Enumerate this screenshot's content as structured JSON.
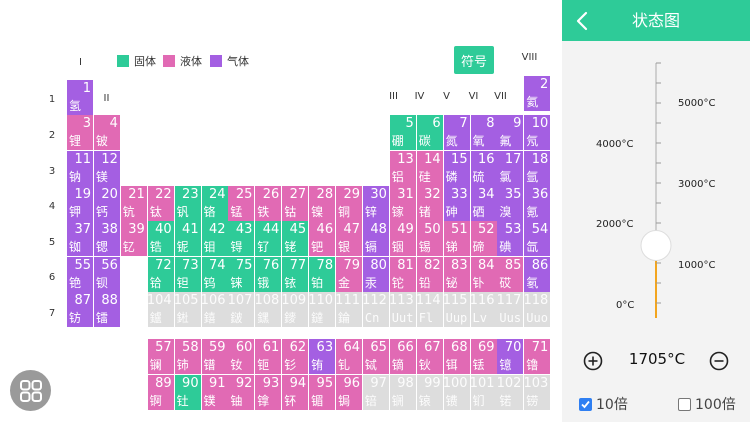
{
  "colors": {
    "solid": "#2ecb98",
    "liquid": "#e16ab4",
    "gas": "#a45fe2",
    "unknown": "#dddddd",
    "accent": "#2ecb98",
    "thermo_fill": "#f2a51f"
  },
  "legend": [
    {
      "label": "固体",
      "state": "solid"
    },
    {
      "label": "液体",
      "state": "liquid"
    },
    {
      "label": "气体",
      "state": "gas"
    }
  ],
  "symbol_button": "符号",
  "group_labels": [
    "I",
    "II",
    "III",
    "IV",
    "V",
    "VI",
    "VII",
    "VIII"
  ],
  "period_labels": [
    "1",
    "2",
    "3",
    "4",
    "5",
    "6",
    "7"
  ],
  "elements": [
    {
      "n": "1",
      "name": "氢",
      "row": 1,
      "col": 1,
      "state": "gas"
    },
    {
      "n": "2",
      "name": "氦",
      "row": 1,
      "col": 18,
      "state": "gas"
    },
    {
      "n": "3",
      "name": "锂",
      "row": 2,
      "col": 1,
      "state": "liquid"
    },
    {
      "n": "4",
      "name": "铍",
      "row": 2,
      "col": 2,
      "state": "liquid"
    },
    {
      "n": "5",
      "name": "硼",
      "row": 2,
      "col": 13,
      "state": "solid"
    },
    {
      "n": "6",
      "name": "碳",
      "row": 2,
      "col": 14,
      "state": "solid"
    },
    {
      "n": "7",
      "name": "氮",
      "row": 2,
      "col": 15,
      "state": "gas"
    },
    {
      "n": "8",
      "name": "氧",
      "row": 2,
      "col": 16,
      "state": "gas"
    },
    {
      "n": "9",
      "name": "氟",
      "row": 2,
      "col": 17,
      "state": "gas"
    },
    {
      "n": "10",
      "name": "氖",
      "row": 2,
      "col": 18,
      "state": "gas"
    },
    {
      "n": "11",
      "name": "钠",
      "row": 3,
      "col": 1,
      "state": "gas"
    },
    {
      "n": "12",
      "name": "镁",
      "row": 3,
      "col": 2,
      "state": "gas"
    },
    {
      "n": "13",
      "name": "铝",
      "row": 3,
      "col": 13,
      "state": "liquid"
    },
    {
      "n": "14",
      "name": "硅",
      "row": 3,
      "col": 14,
      "state": "liquid"
    },
    {
      "n": "15",
      "name": "磷",
      "row": 3,
      "col": 15,
      "state": "gas"
    },
    {
      "n": "16",
      "name": "硫",
      "row": 3,
      "col": 16,
      "state": "gas"
    },
    {
      "n": "17",
      "name": "氯",
      "row": 3,
      "col": 17,
      "state": "gas"
    },
    {
      "n": "18",
      "name": "氩",
      "row": 3,
      "col": 18,
      "state": "gas"
    },
    {
      "n": "19",
      "name": "钾",
      "row": 4,
      "col": 1,
      "state": "gas"
    },
    {
      "n": "20",
      "name": "钙",
      "row": 4,
      "col": 2,
      "state": "gas"
    },
    {
      "n": "21",
      "name": "钪",
      "row": 4,
      "col": 3,
      "state": "liquid"
    },
    {
      "n": "22",
      "name": "钛",
      "row": 4,
      "col": 4,
      "state": "liquid"
    },
    {
      "n": "23",
      "name": "钒",
      "row": 4,
      "col": 5,
      "state": "solid"
    },
    {
      "n": "24",
      "name": "铬",
      "row": 4,
      "col": 6,
      "state": "solid"
    },
    {
      "n": "25",
      "name": "锰",
      "row": 4,
      "col": 7,
      "state": "liquid"
    },
    {
      "n": "26",
      "name": "铁",
      "row": 4,
      "col": 8,
      "state": "liquid"
    },
    {
      "n": "27",
      "name": "钴",
      "row": 4,
      "col": 9,
      "state": "liquid"
    },
    {
      "n": "28",
      "name": "镍",
      "row": 4,
      "col": 10,
      "state": "liquid"
    },
    {
      "n": "29",
      "name": "铜",
      "row": 4,
      "col": 11,
      "state": "liquid"
    },
    {
      "n": "30",
      "name": "锌",
      "row": 4,
      "col": 12,
      "state": "gas"
    },
    {
      "n": "31",
      "name": "镓",
      "row": 4,
      "col": 13,
      "state": "liquid"
    },
    {
      "n": "32",
      "name": "锗",
      "row": 4,
      "col": 14,
      "state": "liquid"
    },
    {
      "n": "33",
      "name": "砷",
      "row": 4,
      "col": 15,
      "state": "gas"
    },
    {
      "n": "34",
      "name": "硒",
      "row": 4,
      "col": 16,
      "state": "gas"
    },
    {
      "n": "35",
      "name": "溴",
      "row": 4,
      "col": 17,
      "state": "gas"
    },
    {
      "n": "36",
      "name": "氪",
      "row": 4,
      "col": 18,
      "state": "gas"
    },
    {
      "n": "37",
      "name": "铷",
      "row": 5,
      "col": 1,
      "state": "gas"
    },
    {
      "n": "38",
      "name": "锶",
      "row": 5,
      "col": 2,
      "state": "gas"
    },
    {
      "n": "39",
      "name": "钇",
      "row": 5,
      "col": 3,
      "state": "liquid"
    },
    {
      "n": "40",
      "name": "锆",
      "row": 5,
      "col": 4,
      "state": "solid"
    },
    {
      "n": "41",
      "name": "铌",
      "row": 5,
      "col": 5,
      "state": "solid"
    },
    {
      "n": "42",
      "name": "钼",
      "row": 5,
      "col": 6,
      "state": "solid"
    },
    {
      "n": "43",
      "name": "锝",
      "row": 5,
      "col": 7,
      "state": "solid"
    },
    {
      "n": "44",
      "name": "钌",
      "row": 5,
      "col": 8,
      "state": "solid"
    },
    {
      "n": "45",
      "name": "铑",
      "row": 5,
      "col": 9,
      "state": "solid"
    },
    {
      "n": "46",
      "name": "钯",
      "row": 5,
      "col": 10,
      "state": "liquid"
    },
    {
      "n": "47",
      "name": "银",
      "row": 5,
      "col": 11,
      "state": "liquid"
    },
    {
      "n": "48",
      "name": "镉",
      "row": 5,
      "col": 12,
      "state": "gas"
    },
    {
      "n": "49",
      "name": "铟",
      "row": 5,
      "col": 13,
      "state": "liquid"
    },
    {
      "n": "50",
      "name": "锡",
      "row": 5,
      "col": 14,
      "state": "liquid"
    },
    {
      "n": "51",
      "name": "锑",
      "row": 5,
      "col": 15,
      "state": "liquid"
    },
    {
      "n": "52",
      "name": "碲",
      "row": 5,
      "col": 16,
      "state": "liquid"
    },
    {
      "n": "53",
      "name": "碘",
      "row": 5,
      "col": 17,
      "state": "gas"
    },
    {
      "n": "54",
      "name": "氙",
      "row": 5,
      "col": 18,
      "state": "gas"
    },
    {
      "n": "55",
      "name": "铯",
      "row": 6,
      "col": 1,
      "state": "gas"
    },
    {
      "n": "56",
      "name": "钡",
      "row": 6,
      "col": 2,
      "state": "gas"
    },
    {
      "n": "72",
      "name": "铪",
      "row": 6,
      "col": 4,
      "state": "solid"
    },
    {
      "n": "73",
      "name": "钽",
      "row": 6,
      "col": 5,
      "state": "solid"
    },
    {
      "n": "74",
      "name": "钨",
      "row": 6,
      "col": 6,
      "state": "solid"
    },
    {
      "n": "75",
      "name": "铼",
      "row": 6,
      "col": 7,
      "state": "solid"
    },
    {
      "n": "76",
      "name": "锇",
      "row": 6,
      "col": 8,
      "state": "solid"
    },
    {
      "n": "77",
      "name": "铱",
      "row": 6,
      "col": 9,
      "state": "solid"
    },
    {
      "n": "78",
      "name": "铂",
      "row": 6,
      "col": 10,
      "state": "solid"
    },
    {
      "n": "79",
      "name": "金",
      "row": 6,
      "col": 11,
      "state": "liquid"
    },
    {
      "n": "80",
      "name": "汞",
      "row": 6,
      "col": 12,
      "state": "gas"
    },
    {
      "n": "81",
      "name": "铊",
      "row": 6,
      "col": 13,
      "state": "liquid"
    },
    {
      "n": "82",
      "name": "铅",
      "row": 6,
      "col": 14,
      "state": "liquid"
    },
    {
      "n": "83",
      "name": "铋",
      "row": 6,
      "col": 15,
      "state": "liquid"
    },
    {
      "n": "84",
      "name": "钋",
      "row": 6,
      "col": 16,
      "state": "liquid"
    },
    {
      "n": "85",
      "name": "砹",
      "row": 6,
      "col": 17,
      "state": "liquid"
    },
    {
      "n": "86",
      "name": "氡",
      "row": 6,
      "col": 18,
      "state": "gas"
    },
    {
      "n": "87",
      "name": "钫",
      "row": 7,
      "col": 1,
      "state": "gas"
    },
    {
      "n": "88",
      "name": "镭",
      "row": 7,
      "col": 2,
      "state": "gas"
    },
    {
      "n": "104",
      "name": "鑪",
      "row": 7,
      "col": 4,
      "state": "unknown"
    },
    {
      "n": "105",
      "name": "𨧀",
      "row": 7,
      "col": 5,
      "state": "unknown"
    },
    {
      "n": "106",
      "name": "𨭎",
      "row": 7,
      "col": 6,
      "state": "unknown"
    },
    {
      "n": "107",
      "name": "𨨏",
      "row": 7,
      "col": 7,
      "state": "unknown"
    },
    {
      "n": "108",
      "name": "𨭆",
      "row": 7,
      "col": 8,
      "state": "unknown"
    },
    {
      "n": "109",
      "name": "䥑",
      "row": 7,
      "col": 9,
      "state": "unknown"
    },
    {
      "n": "110",
      "name": "鐽",
      "row": 7,
      "col": 10,
      "state": "unknown"
    },
    {
      "n": "111",
      "name": "錀",
      "row": 7,
      "col": 11,
      "state": "unknown"
    },
    {
      "n": "112",
      "name": "Cn",
      "row": 7,
      "col": 12,
      "state": "unknown"
    },
    {
      "n": "113",
      "name": "Uut",
      "row": 7,
      "col": 13,
      "state": "unknown"
    },
    {
      "n": "114",
      "name": "Fl",
      "row": 7,
      "col": 14,
      "state": "unknown"
    },
    {
      "n": "115",
      "name": "Uup",
      "row": 7,
      "col": 15,
      "state": "unknown"
    },
    {
      "n": "116",
      "name": "Lv",
      "row": 7,
      "col": 16,
      "state": "unknown"
    },
    {
      "n": "117",
      "name": "Uus",
      "row": 7,
      "col": 17,
      "state": "unknown"
    },
    {
      "n": "118",
      "name": "Uuo",
      "row": 7,
      "col": 18,
      "state": "unknown"
    },
    {
      "n": "57",
      "name": "镧",
      "row": 8,
      "col": 4,
      "state": "liquid"
    },
    {
      "n": "58",
      "name": "铈",
      "row": 8,
      "col": 5,
      "state": "liquid"
    },
    {
      "n": "59",
      "name": "镨",
      "row": 8,
      "col": 6,
      "state": "liquid"
    },
    {
      "n": "60",
      "name": "钕",
      "row": 8,
      "col": 7,
      "state": "liquid"
    },
    {
      "n": "61",
      "name": "钷",
      "row": 8,
      "col": 8,
      "state": "liquid"
    },
    {
      "n": "62",
      "name": "钐",
      "row": 8,
      "col": 9,
      "state": "liquid"
    },
    {
      "n": "63",
      "name": "铕",
      "row": 8,
      "col": 10,
      "state": "gas"
    },
    {
      "n": "64",
      "name": "钆",
      "row": 8,
      "col": 11,
      "state": "liquid"
    },
    {
      "n": "65",
      "name": "铽",
      "row": 8,
      "col": 12,
      "state": "liquid"
    },
    {
      "n": "66",
      "name": "镝",
      "row": 8,
      "col": 13,
      "state": "liquid"
    },
    {
      "n": "67",
      "name": "钬",
      "row": 8,
      "col": 14,
      "state": "liquid"
    },
    {
      "n": "68",
      "name": "铒",
      "row": 8,
      "col": 15,
      "state": "liquid"
    },
    {
      "n": "69",
      "name": "铥",
      "row": 8,
      "col": 16,
      "state": "liquid"
    },
    {
      "n": "70",
      "name": "镱",
      "row": 8,
      "col": 17,
      "state": "gas"
    },
    {
      "n": "71",
      "name": "镥",
      "row": 8,
      "col": 18,
      "state": "liquid"
    },
    {
      "n": "89",
      "name": "锕",
      "row": 9,
      "col": 4,
      "state": "liquid"
    },
    {
      "n": "90",
      "name": "钍",
      "row": 9,
      "col": 5,
      "state": "solid"
    },
    {
      "n": "91",
      "name": "镤",
      "row": 9,
      "col": 6,
      "state": "liquid"
    },
    {
      "n": "92",
      "name": "铀",
      "row": 9,
      "col": 7,
      "state": "liquid"
    },
    {
      "n": "93",
      "name": "镎",
      "row": 9,
      "col": 8,
      "state": "liquid"
    },
    {
      "n": "94",
      "name": "钚",
      "row": 9,
      "col": 9,
      "state": "liquid"
    },
    {
      "n": "95",
      "name": "镅",
      "row": 9,
      "col": 10,
      "state": "liquid"
    },
    {
      "n": "96",
      "name": "锔",
      "row": 9,
      "col": 11,
      "state": "liquid"
    },
    {
      "n": "97",
      "name": "锫",
      "row": 9,
      "col": 12,
      "state": "unknown"
    },
    {
      "n": "98",
      "name": "锎",
      "row": 9,
      "col": 13,
      "state": "unknown"
    },
    {
      "n": "99",
      "name": "锿",
      "row": 9,
      "col": 14,
      "state": "unknown"
    },
    {
      "n": "100",
      "name": "镄",
      "row": 9,
      "col": 15,
      "state": "unknown"
    },
    {
      "n": "101",
      "name": "钔",
      "row": 9,
      "col": 16,
      "state": "unknown"
    },
    {
      "n": "102",
      "name": "锘",
      "row": 9,
      "col": 17,
      "state": "unknown"
    },
    {
      "n": "103",
      "name": "铹",
      "row": 9,
      "col": 18,
      "state": "unknown"
    }
  ],
  "menu_icon": "grid-icon",
  "panel": {
    "title": "状态图",
    "back_icon": "chevron-left-icon",
    "thermometer": {
      "ticks_right": [
        "5000°C",
        "3000°C",
        "1000°C"
      ],
      "ticks_left": [
        "4000°C",
        "2000°C",
        "0°C"
      ],
      "level_celsius": 1705,
      "max_celsius": 6000
    },
    "minus_icon": "minus-circle-icon",
    "plus_icon": "plus-circle-icon",
    "temperature_display": "1705°C",
    "multipliers": [
      {
        "label": "10倍",
        "checked": true
      },
      {
        "label": "100倍",
        "checked": false
      }
    ]
  }
}
